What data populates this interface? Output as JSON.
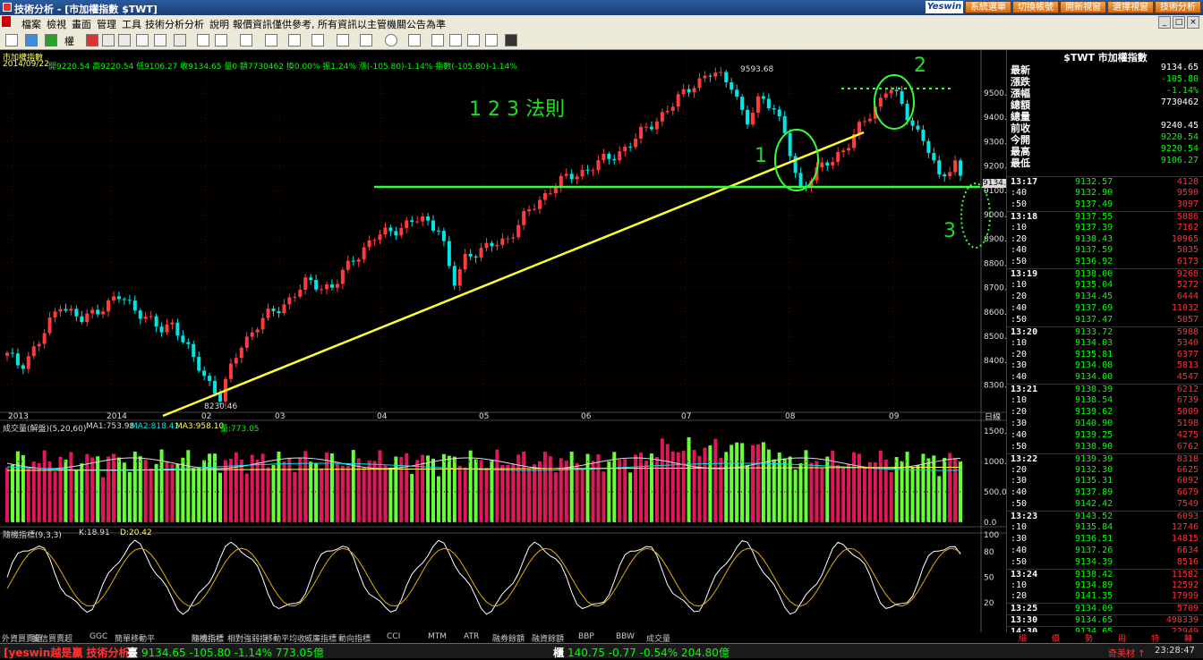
{
  "window": {
    "title": "技術分析 - [市加權指數 $TWT]",
    "logo": "Yeswin"
  },
  "top_buttons": [
    "系統選單",
    "切換帳號",
    "開新視窗",
    "選擇視窗",
    "技術分析"
  ],
  "window_controls": [
    "_",
    "□",
    "×"
  ],
  "menu": [
    "檔案",
    "檢視",
    "畫面",
    "管理",
    "工具",
    "技術分析",
    "分析",
    "說明",
    "報價資訊僅供參考, 所有資訊以主管機關公告為準"
  ],
  "toolbar": {
    "period_label": "權"
  },
  "chart": {
    "symbol": "市加權指數",
    "info_date": "2014/09/22",
    "info_line": "開9220.54 高9220.54 低9106.27 收9134.65 量0 額7730462 換0.00% 振1.24% 漲(-105.80)-1.14% 指數(-105.80)-1.14%",
    "annotation_title": "1 2 3 法則",
    "ann1": "1",
    "ann2": "2",
    "ann3": "3",
    "high_label": "9593.68",
    "low_label": "8230.46",
    "current_price_tag": "9134.7",
    "y_ticks": [
      "9500.0",
      "9400.0",
      "9300.0",
      "9200.0",
      "9100.0",
      "9000.0",
      "8900.0",
      "8800.0",
      "8700.0",
      "8600.0",
      "8500.0",
      "8400.0",
      "8300.0"
    ],
    "x_ticks": [
      "2013",
      "2014",
      "02",
      "03",
      "04",
      "05",
      "06",
      "07",
      "08",
      "09"
    ],
    "period_tag": "日線"
  },
  "volume_panel": {
    "header_name": "成交量(解盤)(5,20,60)",
    "ma1": "MA1:753.98",
    "ma2": "MA2:818.41",
    "ma3": "MA3:958.10",
    "vol": "量:773.05",
    "y_ticks": [
      "1500.0",
      "1000.0",
      "500.0",
      "0.0"
    ]
  },
  "kd_panel": {
    "header_name": "隨機指標(9,3,3)",
    "k": "K:18.91",
    "d": "D:20.42",
    "y_ticks": [
      "100",
      "80",
      "50",
      "20"
    ]
  },
  "indicator_tabs": [
    "外資買賣超",
    "投信買賣超",
    "GGC",
    "簡單移動平",
    "隨機指標",
    "隨機指標",
    "相對強弱指",
    "移動平均收",
    "威廉指標",
    "動向指標",
    "CCI",
    "MTM",
    "ATR",
    "融券餘額",
    "融資餘額",
    "BBP",
    "BBW",
    "成交量"
  ],
  "quote": {
    "header": "$TWT 市加權指數",
    "fields": [
      {
        "label": "最新",
        "value": "9134.65",
        "color": "#ffffff"
      },
      {
        "label": "漲跌",
        "value": "-105.80",
        "color": "#00ff00"
      },
      {
        "label": "漲幅",
        "value": "-1.14%",
        "color": "#00ff00"
      },
      {
        "label": "總額",
        "value": "7730462",
        "color": "#ffffff"
      },
      {
        "label": "總量",
        "value": "",
        "color": "#ffffff"
      },
      {
        "label": "前收",
        "value": "9240.45",
        "color": "#ffffff"
      },
      {
        "label": "今開",
        "value": "9220.54",
        "color": "#00ff00"
      },
      {
        "label": "最高",
        "value": "9220.54",
        "color": "#00ff00"
      },
      {
        "label": "最低",
        "value": "9106.27",
        "color": "#00ff00"
      }
    ],
    "ticks": [
      {
        "time": "13:17",
        "price": "9132.57",
        "vol": "4128",
        "bold": true
      },
      {
        "time": ":40",
        "price": "9132.90",
        "vol": "9590"
      },
      {
        "time": ":50",
        "price": "9137.49",
        "vol": "3097"
      },
      {
        "time": "13:18",
        "price": "9137.55",
        "vol": "5086",
        "bold": true
      },
      {
        "time": ":10",
        "price": "9137.39",
        "vol": "7162"
      },
      {
        "time": ":20",
        "price": "9138.43",
        "vol": "10965"
      },
      {
        "time": ":40",
        "price": "9137.59",
        "vol": "5035"
      },
      {
        "time": ":50",
        "price": "9136.92",
        "vol": "6173"
      },
      {
        "time": "13:19",
        "price": "9138.00",
        "vol": "9268",
        "bold": true
      },
      {
        "time": ":10",
        "price": "9135.04",
        "vol": "5272"
      },
      {
        "time": ":20",
        "price": "9134.45",
        "vol": "6444"
      },
      {
        "time": ":40",
        "price": "9137.69",
        "vol": "11032"
      },
      {
        "time": ":50",
        "price": "9137.47",
        "vol": "5057"
      },
      {
        "time": "13:20",
        "price": "9133.72",
        "vol": "5988",
        "bold": true
      },
      {
        "time": ":10",
        "price": "9134.03",
        "vol": "5340"
      },
      {
        "time": ":20",
        "price": "9135.81",
        "vol": "6377"
      },
      {
        "time": ":30",
        "price": "9134.08",
        "vol": "5813"
      },
      {
        "time": ":40",
        "price": "9134.00",
        "vol": "4547"
      },
      {
        "time": "13:21",
        "price": "9138.39",
        "vol": "6212",
        "bold": true
      },
      {
        "time": ":10",
        "price": "9138.54",
        "vol": "6739"
      },
      {
        "time": ":20",
        "price": "9139.62",
        "vol": "5009"
      },
      {
        "time": ":30",
        "price": "9140.90",
        "vol": "5198"
      },
      {
        "time": ":40",
        "price": "9139.25",
        "vol": "4275"
      },
      {
        "time": ":50",
        "price": "9138.90",
        "vol": "6762"
      },
      {
        "time": "13:22",
        "price": "9139.39",
        "vol": "8318",
        "bold": true
      },
      {
        "time": ":20",
        "price": "9132.30",
        "vol": "6625"
      },
      {
        "time": ":30",
        "price": "9135.31",
        "vol": "6092"
      },
      {
        "time": ":40",
        "price": "9137.89",
        "vol": "6679"
      },
      {
        "time": ":50",
        "price": "9142.42",
        "vol": "7549"
      },
      {
        "time": "13:23",
        "price": "9143.52",
        "vol": "6093",
        "bold": true
      },
      {
        "time": ":10",
        "price": "9135.84",
        "vol": "12746"
      },
      {
        "time": ":30",
        "price": "9136.51",
        "vol": "14815"
      },
      {
        "time": ":40",
        "price": "9137.26",
        "vol": "6634"
      },
      {
        "time": ":50",
        "price": "9134.39",
        "vol": "8516"
      },
      {
        "time": "13:24",
        "price": "9138.42",
        "vol": "11582",
        "bold": true
      },
      {
        "time": ":10",
        "price": "9134.89",
        "vol": "12592"
      },
      {
        "time": ":20",
        "price": "9141.35",
        "vol": "17999"
      },
      {
        "time": "13:25",
        "price": "9134.09",
        "vol": "5709",
        "bold": true
      },
      {
        "time": "13:30",
        "price": "9134.65",
        "vol": "498339",
        "bold": true
      },
      {
        "time": "14:30",
        "price": "9134.65",
        "vol": "22949",
        "bold": true
      }
    ],
    "bottom_tabs": [
      "細",
      "價",
      "勢",
      "周",
      "特",
      "轉"
    ]
  },
  "ticker": {
    "brand": "[yeswin越是贏 技術分析]",
    "idx_label": "臺",
    "idx": "9134.65 -105.80 -1.14% 773.05億",
    "otc_label": "櫃",
    "otc": "140.75 -0.77 -0.54% 204.80億",
    "alert": "奇美材 ↑",
    "time": "23:28:47"
  },
  "colors": {
    "up": "#ff3b3b",
    "down": "#00e5e5",
    "vol_up": "#e0185a",
    "vol_down": "#66ff33",
    "trend": "#ffff33",
    "support": "#33ff33"
  }
}
